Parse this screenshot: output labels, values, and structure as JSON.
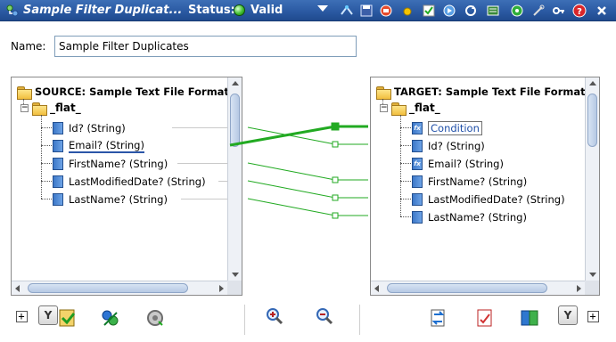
{
  "titlebar": {
    "title": "Sample Filter Duplicat...",
    "status_label": "Status:",
    "status_value": "Valid",
    "colors": {
      "bar": "#2b5aa3",
      "status_ok": "#3fbe2f"
    },
    "icons": [
      "tree-connect-icon",
      "save-icon",
      "deploy-icon",
      "yellow-dot-icon",
      "validate-icon",
      "run-icon",
      "refresh-icon",
      "schema-icon",
      "green-circle-icon",
      "tools-icon",
      "key-icon",
      "help-icon",
      "close-icon"
    ]
  },
  "name": {
    "label": "Name:",
    "value": "Sample Filter Duplicates"
  },
  "source": {
    "root": "SOURCE: Sample Text File Format",
    "flat": "_flat_",
    "fields": [
      "Id? (String)",
      "Email? (String)",
      "FirstName? (String)",
      "LastModifiedDate? (String)",
      "LastName? (String)"
    ]
  },
  "target": {
    "root": "TARGET: Sample Text File Format",
    "flat": "_flat_",
    "fields": [
      "Condition",
      "Id? (String)",
      "Email? (String)",
      "FirstName? (String)",
      "LastModifiedDate? (String)",
      "LastName? (String)"
    ]
  },
  "mapping": {
    "color": "#22aa22",
    "links": [
      {
        "from": "Id? (String)",
        "to": "Id? (String)"
      },
      {
        "from": "Email? (String)",
        "to": "Condition",
        "highlighted": true
      },
      {
        "from": "FirstName? (String)",
        "to": "FirstName? (String)"
      },
      {
        "from": "LastModifiedDate? (String)",
        "to": "LastModifiedDate? (String)"
      },
      {
        "from": "LastName? (String)",
        "to": "LastName? (String)"
      }
    ]
  },
  "bottom_toolbar": {
    "expand_left": "+",
    "filter_left": "Y",
    "filter_right": "Y",
    "expand_right": "+",
    "icons": [
      "auto-map-icon",
      "link-icon",
      "settings-icon",
      "zoom-in-icon",
      "zoom-out-icon",
      "swap-icon",
      "validate-map-icon",
      "refresh-schema-icon"
    ]
  }
}
